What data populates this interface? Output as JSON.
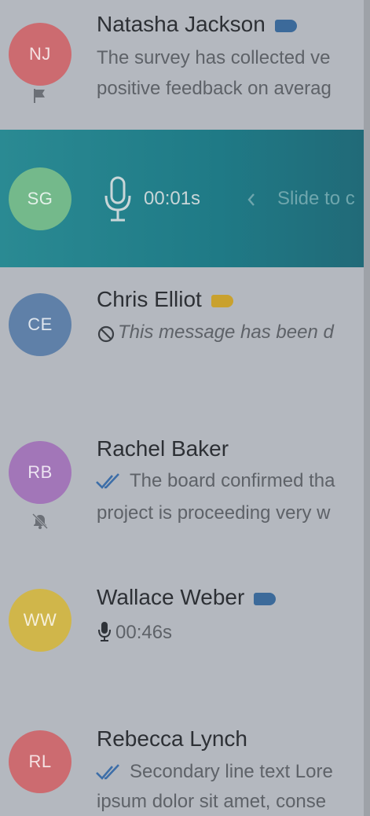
{
  "contacts": [
    {
      "initials": "NJ",
      "name": "Natasha Jackson",
      "line1": "The survey has collected ve",
      "line2": "positive feedback on averag",
      "avatar_color": "#cc6b70",
      "tag_color": "#3c6a9a",
      "status_icon": "flag-icon"
    },
    {
      "initials": "SG",
      "timer": "00:01s",
      "slide_text": "Slide to c",
      "avatar_color": "#74b98b",
      "state": "recording"
    },
    {
      "initials": "CE",
      "name": "Chris Elliot",
      "line1": "This message has been d",
      "avatar_color": "#5f80a8",
      "tag_color": "#c9a12e",
      "line_icon": "blocked-icon"
    },
    {
      "initials": "RB",
      "name": "Rachel Baker",
      "line1": "The board confirmed tha",
      "line2": "project is proceeding very w",
      "avatar_color": "#a276b8",
      "line_icon": "double-check-icon",
      "status_icon": "bell-off-icon"
    },
    {
      "initials": "WW",
      "name": "Wallace Weber",
      "line1": "00:46s",
      "avatar_color": "#d0b64a",
      "tag_color": "#3c6a9a",
      "line_icon": "mic-icon"
    },
    {
      "initials": "RL",
      "name": "Rebecca Lynch",
      "line1": "Secondary line text Lore",
      "line2": "ipsum dolor sit amet, conse",
      "avatar_color": "#cc6b70",
      "line_icon": "double-check-icon"
    }
  ]
}
